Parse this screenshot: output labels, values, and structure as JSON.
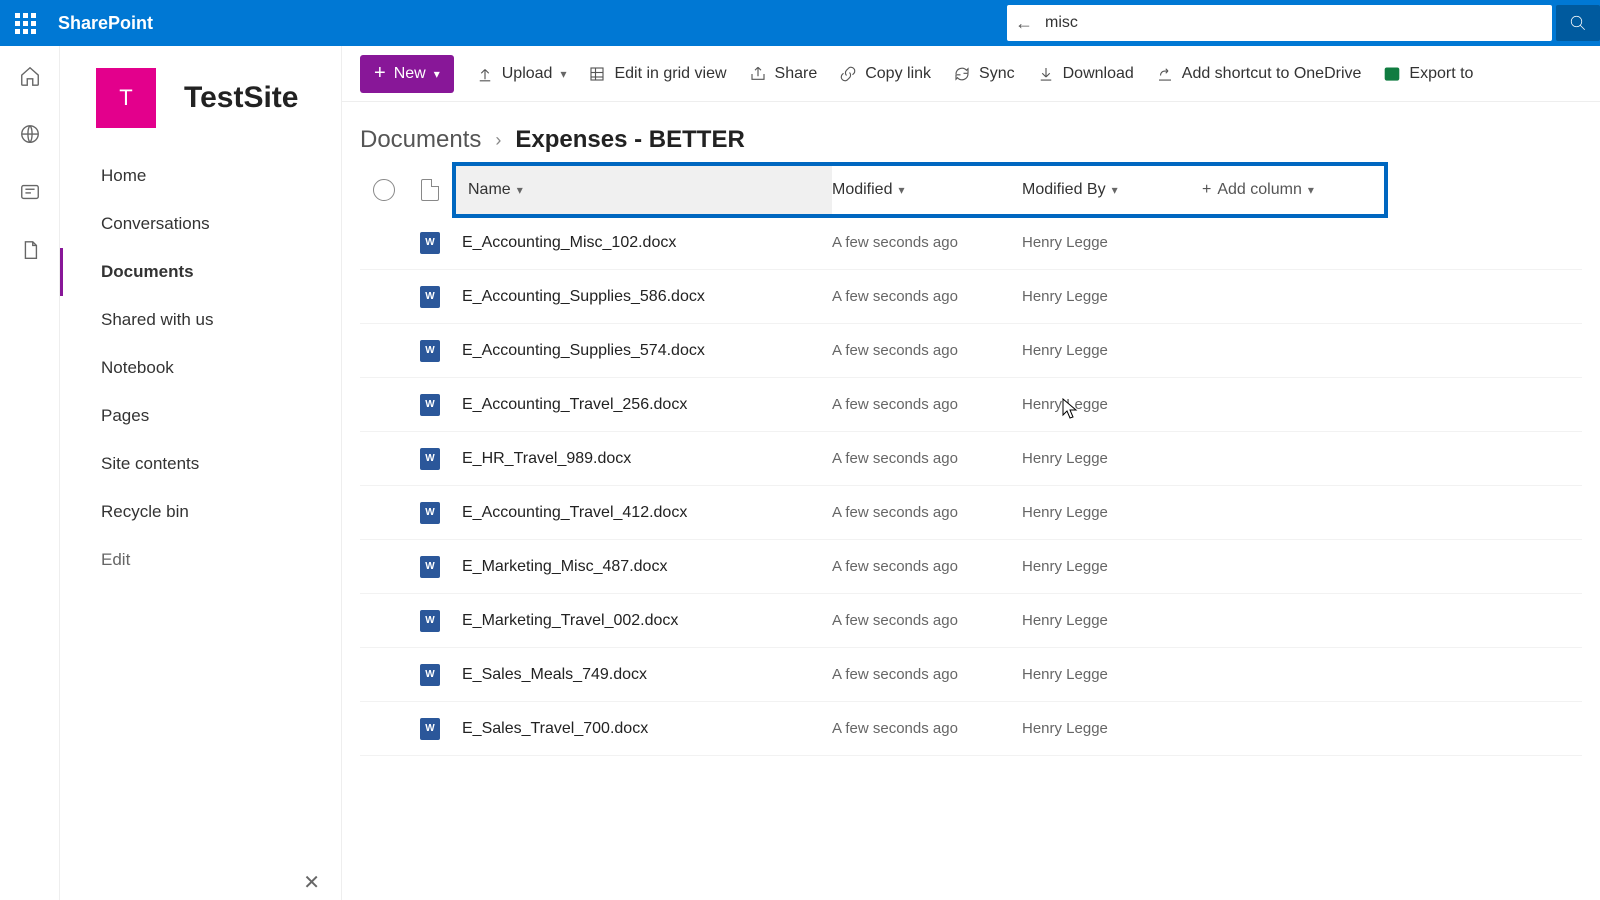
{
  "brand": "SharePoint",
  "search": {
    "value": "misc"
  },
  "site": {
    "initial": "T",
    "title": "TestSite"
  },
  "nav": {
    "items": [
      {
        "label": "Home"
      },
      {
        "label": "Conversations"
      },
      {
        "label": "Documents"
      },
      {
        "label": "Shared with us"
      },
      {
        "label": "Notebook"
      },
      {
        "label": "Pages"
      },
      {
        "label": "Site contents"
      },
      {
        "label": "Recycle bin"
      },
      {
        "label": "Edit"
      }
    ],
    "selected": "Documents"
  },
  "commands": {
    "new": "New",
    "upload": "Upload",
    "editGrid": "Edit in grid view",
    "share": "Share",
    "copyLink": "Copy link",
    "sync": "Sync",
    "download": "Download",
    "shortcut": "Add shortcut to OneDrive",
    "export": "Export to"
  },
  "breadcrumb": {
    "root": "Documents",
    "current": "Expenses - BETTER"
  },
  "columns": {
    "name": "Name",
    "modified": "Modified",
    "modifiedBy": "Modified By",
    "add": "Add column"
  },
  "files": [
    {
      "name": "E_Accounting_Misc_102.docx",
      "modified": "A few seconds ago",
      "modifiedBy": "Henry Legge"
    },
    {
      "name": "E_Accounting_Supplies_586.docx",
      "modified": "A few seconds ago",
      "modifiedBy": "Henry Legge"
    },
    {
      "name": "E_Accounting_Supplies_574.docx",
      "modified": "A few seconds ago",
      "modifiedBy": "Henry Legge"
    },
    {
      "name": "E_Accounting_Travel_256.docx",
      "modified": "A few seconds ago",
      "modifiedBy": "Henry Legge"
    },
    {
      "name": "E_HR_Travel_989.docx",
      "modified": "A few seconds ago",
      "modifiedBy": "Henry Legge"
    },
    {
      "name": "E_Accounting_Travel_412.docx",
      "modified": "A few seconds ago",
      "modifiedBy": "Henry Legge"
    },
    {
      "name": "E_Marketing_Misc_487.docx",
      "modified": "A few seconds ago",
      "modifiedBy": "Henry Legge"
    },
    {
      "name": "E_Marketing_Travel_002.docx",
      "modified": "A few seconds ago",
      "modifiedBy": "Henry Legge"
    },
    {
      "name": "E_Sales_Meals_749.docx",
      "modified": "A few seconds ago",
      "modifiedBy": "Henry Legge"
    },
    {
      "name": "E_Sales_Travel_700.docx",
      "modified": "A few seconds ago",
      "modifiedBy": "Henry Legge"
    }
  ]
}
